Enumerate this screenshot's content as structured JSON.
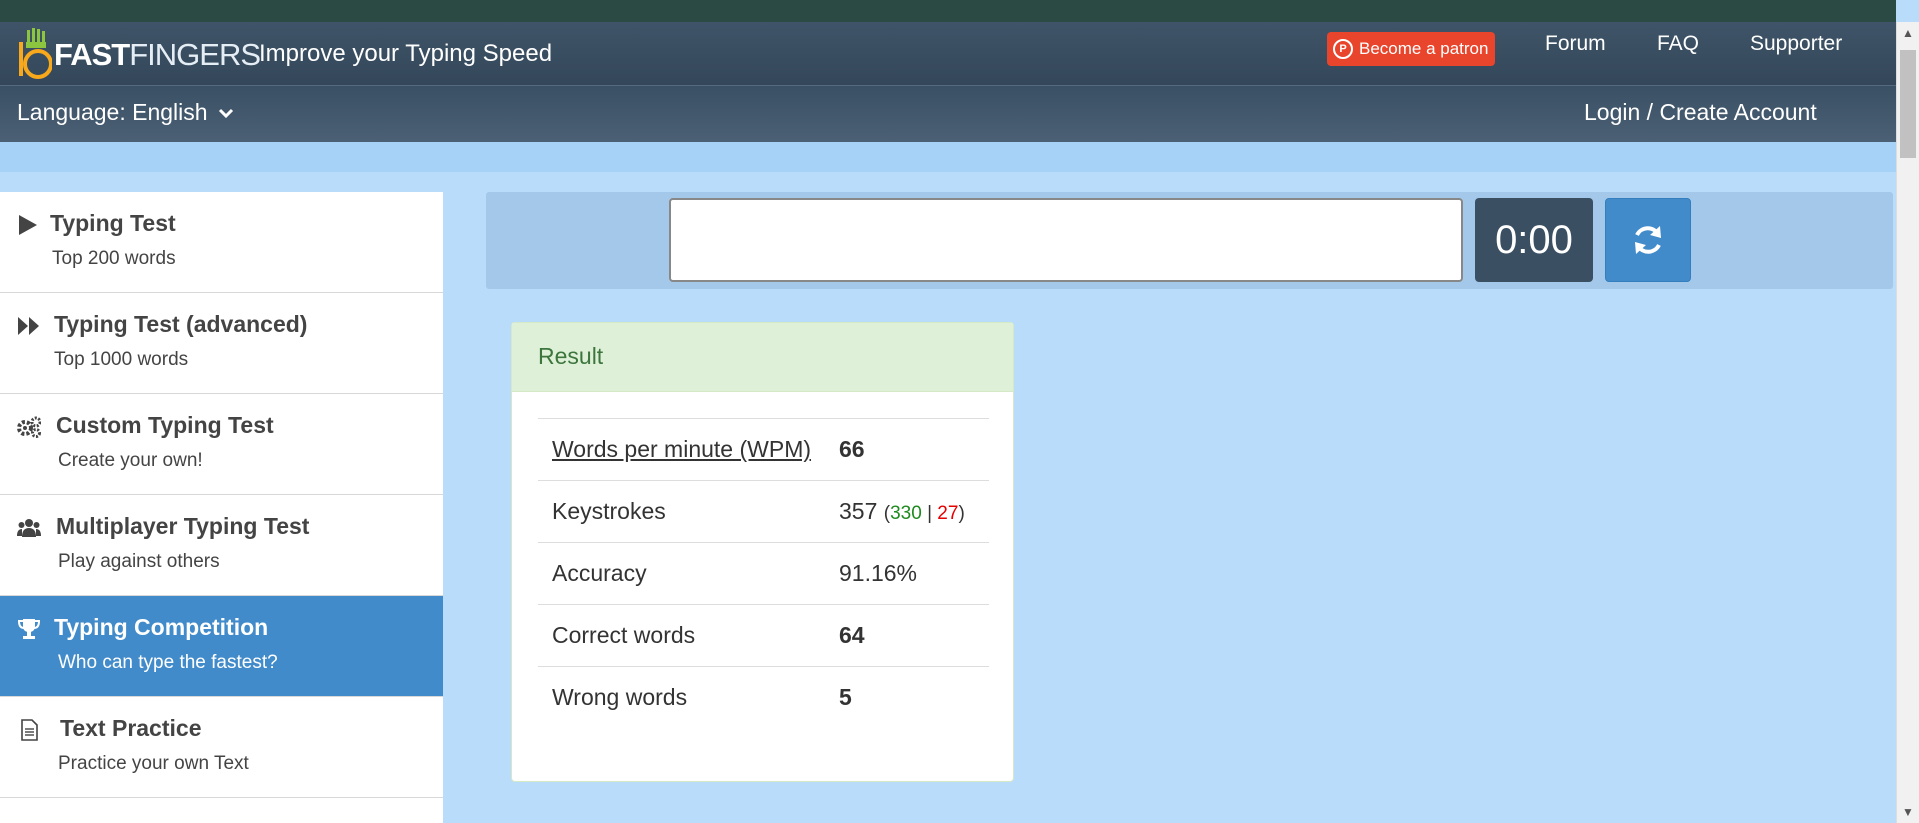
{
  "header": {
    "logo_bold": "FAST",
    "logo_light": "FINGERS",
    "tagline": "Improve your Typing Speed",
    "patron_label": "Become a patron",
    "nav": [
      "Forum",
      "FAQ",
      "Supporter"
    ]
  },
  "langbar": {
    "language": "Language: English",
    "login": "Login / Create Account"
  },
  "sidebar": {
    "items": [
      {
        "title": "Typing Test",
        "subtitle": "Top 200 words",
        "icon": "play-icon"
      },
      {
        "title": "Typing Test (advanced)",
        "subtitle": "Top 1000 words",
        "icon": "fast-forward-icon"
      },
      {
        "title": "Custom Typing Test",
        "subtitle": "Create your own!",
        "icon": "gears-icon"
      },
      {
        "title": "Multiplayer Typing Test",
        "subtitle": "Play against others",
        "icon": "users-icon"
      },
      {
        "title": "Typing Competition",
        "subtitle": "Who can type the fastest?",
        "icon": "trophy-icon",
        "active": true
      },
      {
        "title": "Text Practice",
        "subtitle": "Practice your own Text",
        "icon": "document-icon"
      }
    ]
  },
  "typing": {
    "input_value": "",
    "timer": "0:00"
  },
  "result": {
    "heading": "Result",
    "wpm_label": "Words per minute (WPM)",
    "wpm_value": "66",
    "keystrokes_label": "Keystrokes",
    "keystrokes_total": "357",
    "keystrokes_correct": "330",
    "keystrokes_wrong": "27",
    "accuracy_label": "Accuracy",
    "accuracy_value": "91.16%",
    "correct_label": "Correct words",
    "correct_value": "64",
    "wrong_label": "Wrong words",
    "wrong_value": "5"
  },
  "colors": {
    "header_bg": "#3f5468",
    "active_item": "#428bca",
    "page_bg": "#b9dcfb",
    "patron": "#e8452c",
    "result_head": "#dff0d8"
  }
}
